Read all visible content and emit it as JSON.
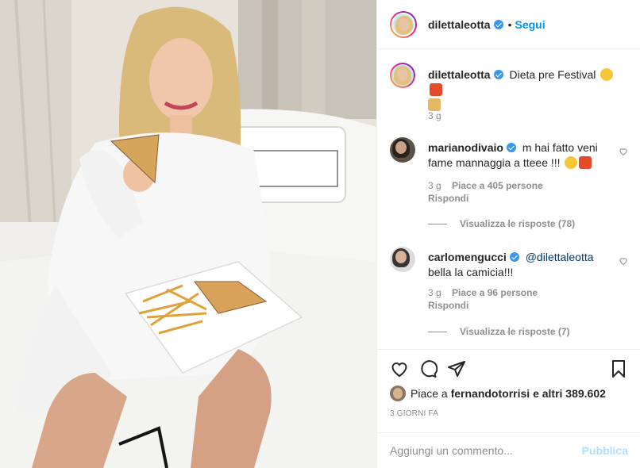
{
  "header": {
    "username": "dilettaleotta",
    "separator": "•",
    "follow_label": "Segui"
  },
  "caption": {
    "username": "dilettaleotta",
    "text": "Dieta pre Festival",
    "emojis": [
      "rolling-on-floor-laughing",
      "french-fries",
      "sandwich"
    ],
    "time": "3 g"
  },
  "comments": [
    {
      "username": "marianodivaio",
      "text": "m hai fatto veni fame mannaggia a tteee !!!",
      "emojis": [
        "face-savoring-food",
        "french-fries"
      ],
      "time": "3 g",
      "likes": "Piace a 405 persone",
      "reply_label": "Rispondi",
      "view_replies": "Visualizza le risposte (78)"
    },
    {
      "username": "carlomengucci",
      "mention": "@dilettaleotta",
      "text": "bella la camicia!!!",
      "time": "3 g",
      "likes": "Piace a 96 persone",
      "reply_label": "Rispondi",
      "view_replies": "Visualizza le risposte (7)"
    }
  ],
  "likes": {
    "prefix": "Piace a",
    "user": "fernandotorrisi",
    "suffix": "e altri 389.602"
  },
  "timestamp": "3 GIORNI FA",
  "add_comment": {
    "placeholder": "Aggiungi un commento...",
    "publish_label": "Pubblica"
  },
  "icons": [
    "heart-icon",
    "comment-icon",
    "share-icon",
    "bookmark-icon"
  ],
  "colors": {
    "accent": "#0095f6",
    "verified": "#3897f0",
    "muted": "#8e8e8e",
    "publish_disabled": "#b2dffc"
  }
}
